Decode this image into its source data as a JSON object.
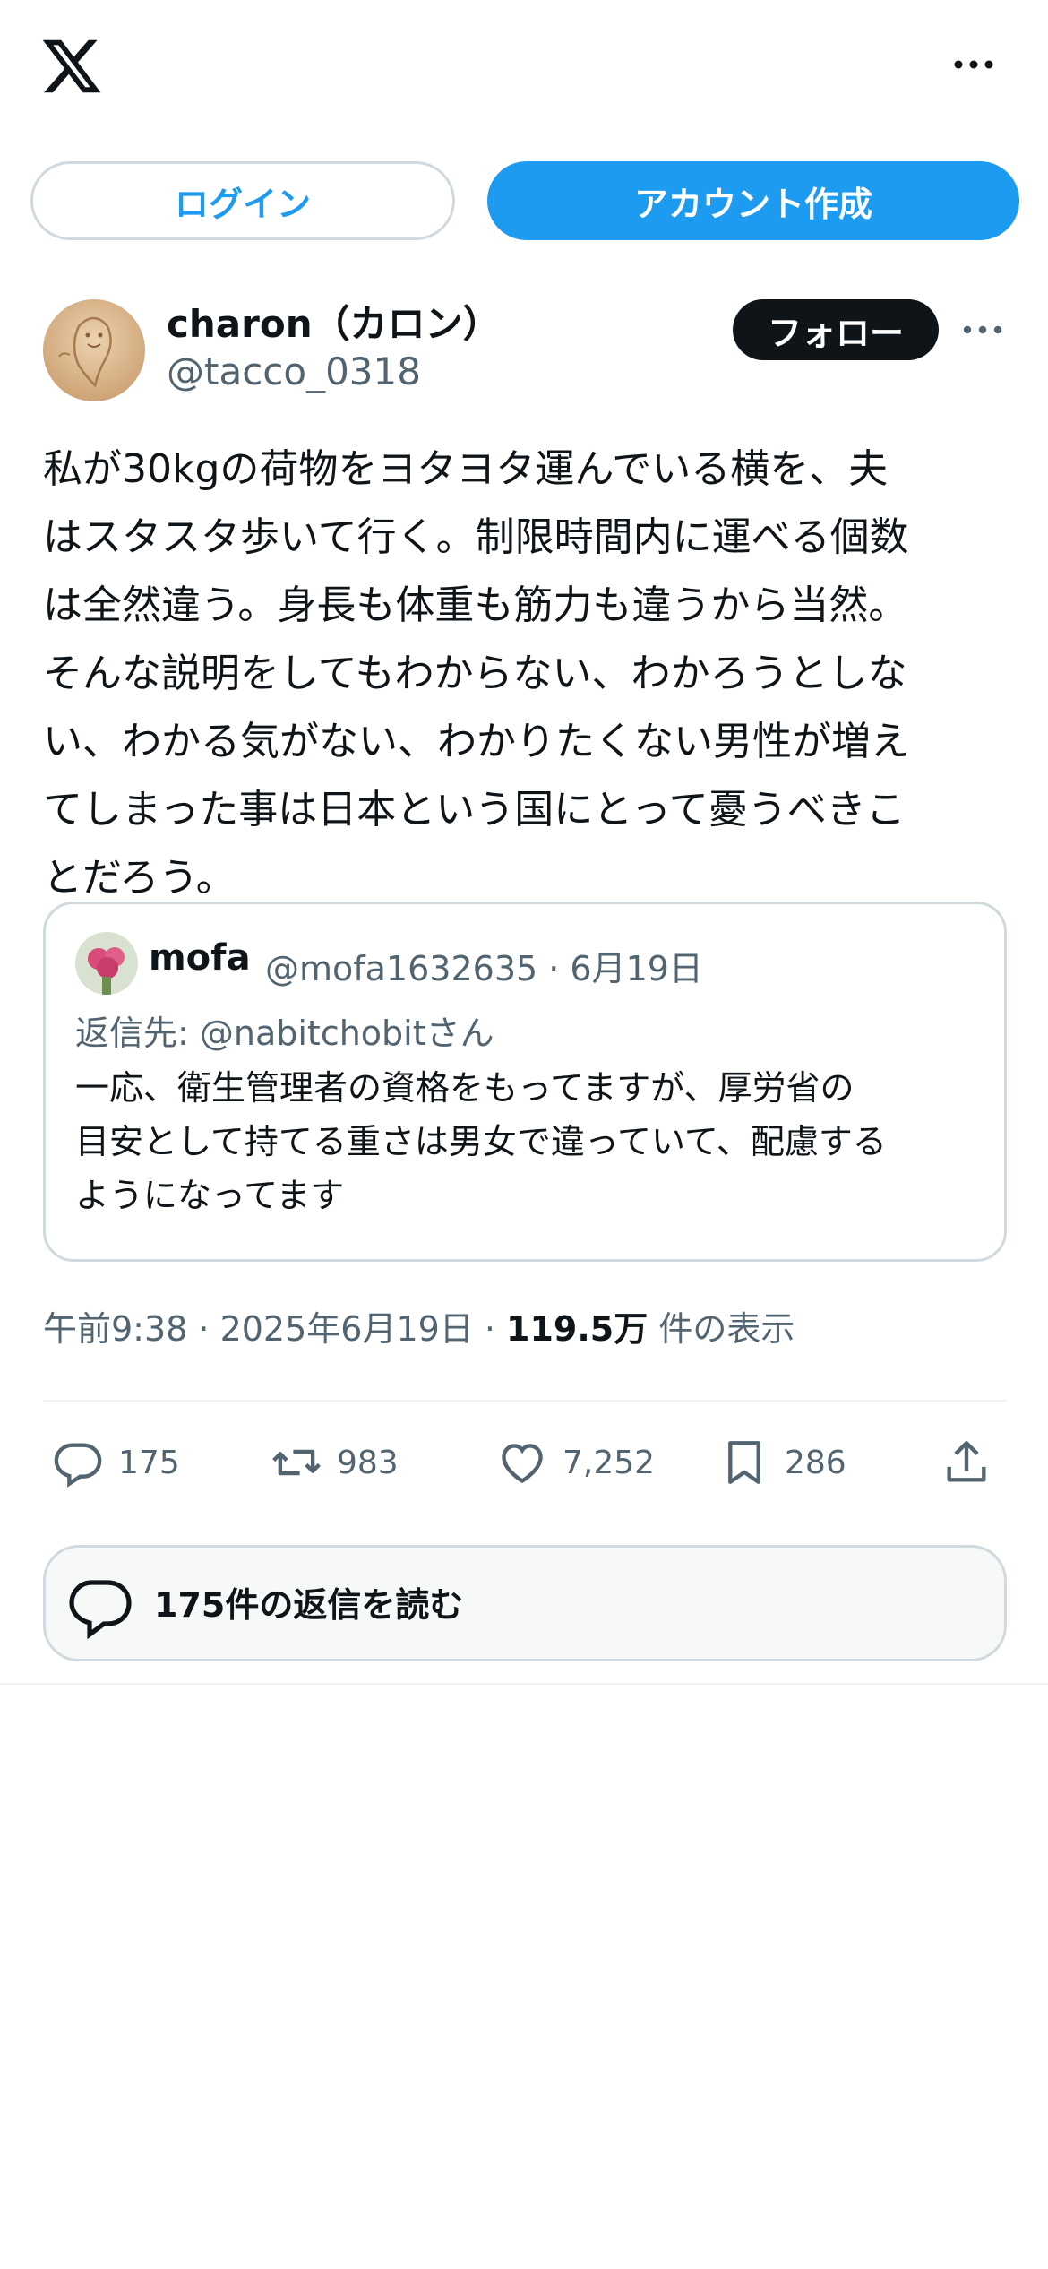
{
  "header": {
    "logo_icon": "x-logo-icon",
    "more_icon": "more-horizontal-icon"
  },
  "auth": {
    "login_label": "ログイン",
    "signup_label": "アカウント作成"
  },
  "post": {
    "author_name": "charon（カロン）",
    "author_handle": "@tacco_0318",
    "follow_label": "フォロー",
    "text": "私が30kgの荷物をヨタヨタ運んでいる横を、夫\nはスタスタ歩いて行く。制限時間内に運べる個数\nは全然違う。身長も体重も筋力も違うから当然。\nそんな説明をしてもわからない、わかろうとしな\nい、わかる気がない、わかりたくない男性が増え\nてしまった事は日本という国にとって憂うべきこ\nとだろう。",
    "quote": {
      "name": "mofa",
      "handle_date": "@mofa1632635 · 6月19日",
      "reply_to": "返信先: @nabitchobitさん",
      "text": "一応、衛生管理者の資格をもってますが、厚労省の\n目安として持てる重さは男女で違っていて、配慮する\nようになってます"
    },
    "time": "午前9:38 · 2025年6月19日 · ",
    "views_count": "119.5万",
    "views_label": " 件の表示",
    "actions": {
      "replies": "175",
      "reposts": "983",
      "likes": "7,252",
      "bookmarks": "286"
    },
    "read_replies_label": "175件の返信を読む"
  },
  "colors": {
    "accent": "#1d9bf0",
    "text": "#0f1419",
    "secondary": "#536471",
    "border": "#cfd9de"
  }
}
